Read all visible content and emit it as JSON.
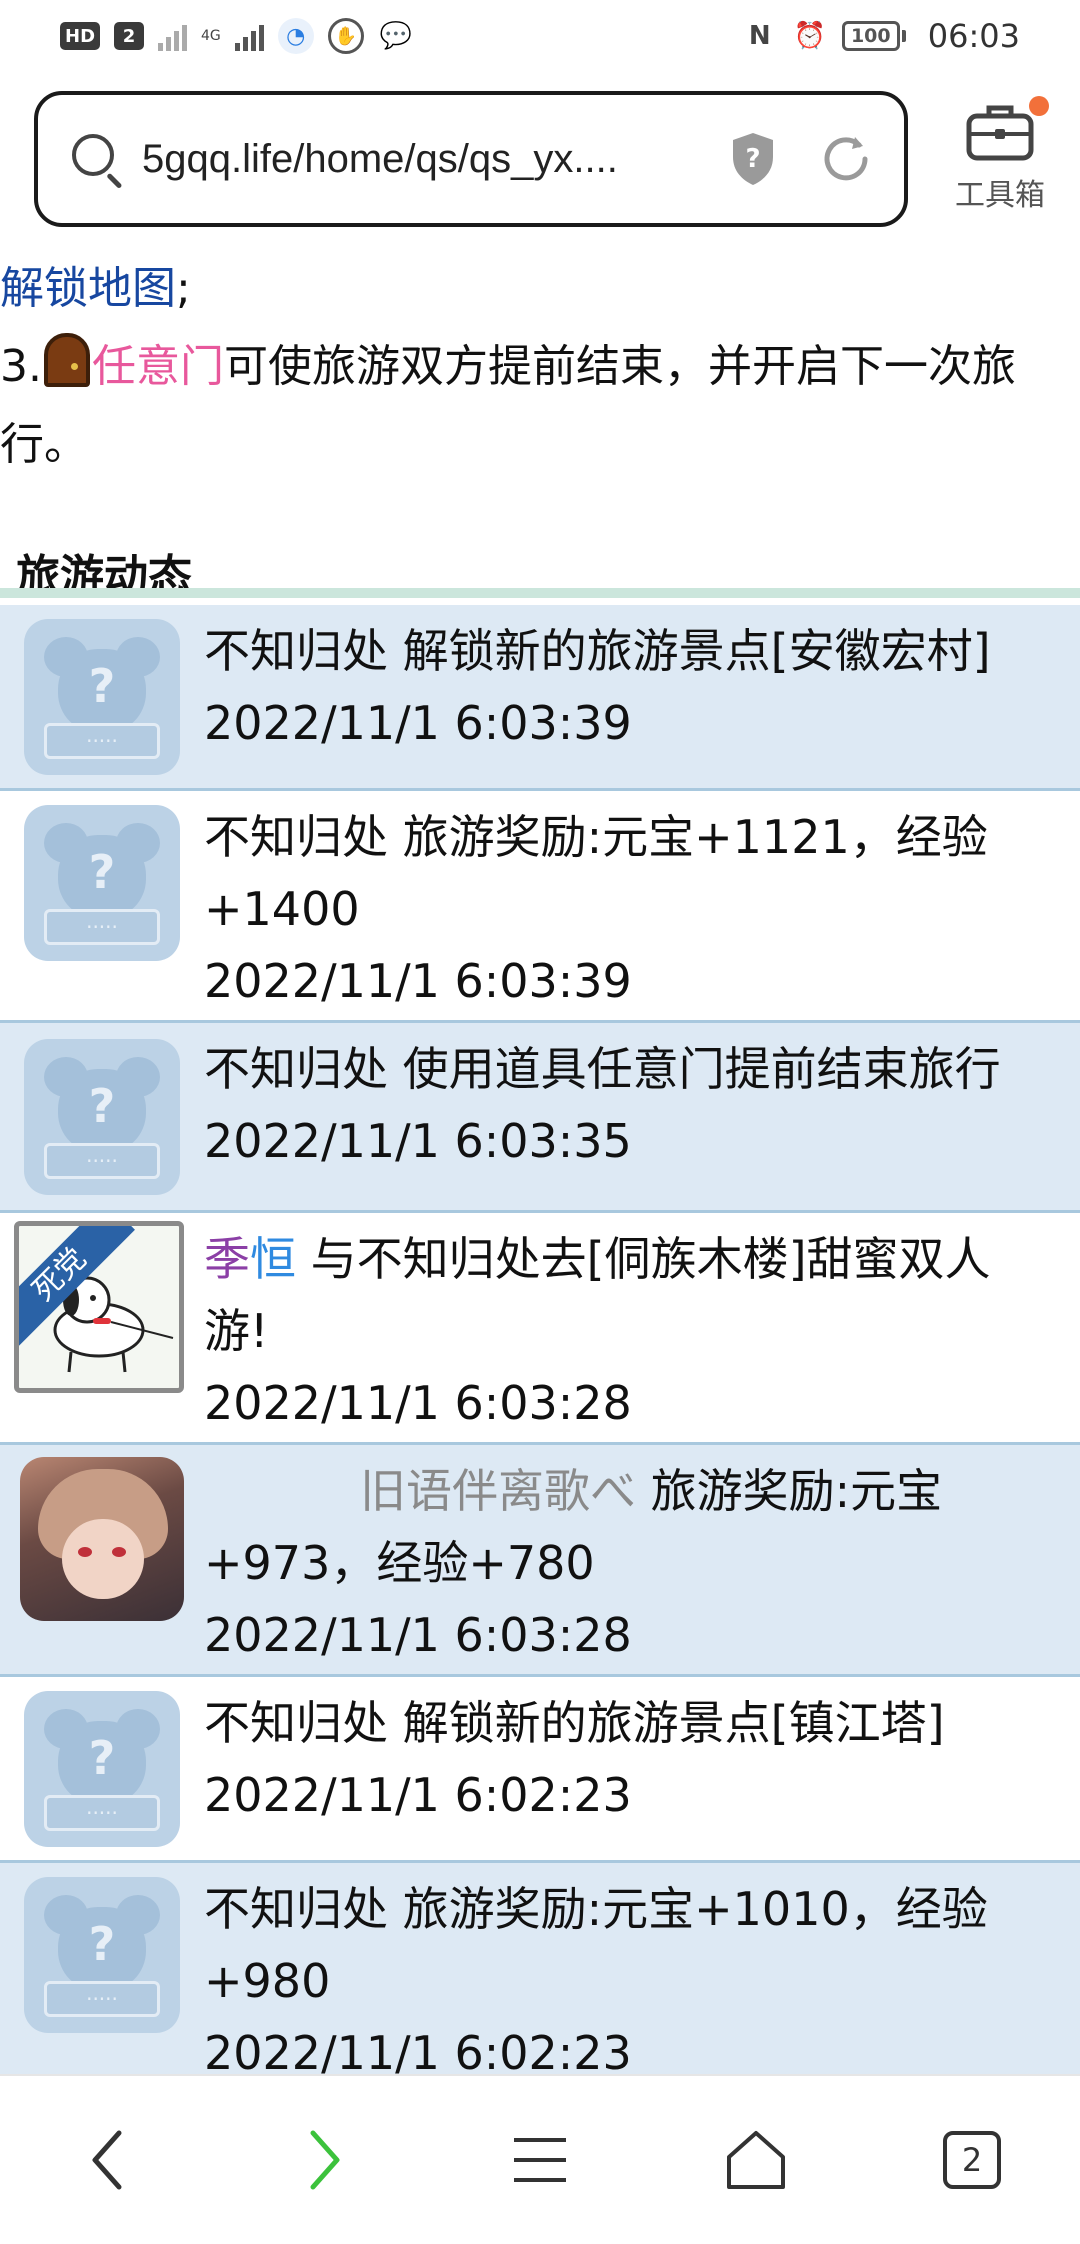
{
  "status_bar": {
    "hd_label": "HD",
    "sim_label": "2",
    "net_label": "4G",
    "battery": "100",
    "time": "06:03"
  },
  "browser": {
    "url": "5gqq.life/home/qs/qs_yx....",
    "toolbox_label": "工具箱"
  },
  "intro": {
    "link_map": "解锁地图",
    "link_map_suffix": ";",
    "line3_prefix": "3.",
    "door_link": "任意门",
    "line3_text": "可使旅游双方提前结束，并开启下一次旅行。"
  },
  "section": {
    "title": "旅游动态"
  },
  "feed": [
    {
      "text": "不知归处 解锁新的旅游景点[安徽宏村]",
      "time": "2022/11/1 6:03:39"
    },
    {
      "text": "不知归处 旅游奖励:元宝+1121，经验+1400",
      "time": "2022/11/1 6:03:39"
    },
    {
      "text": "不知归处 使用道具任意门提前结束旅行",
      "time": "2022/11/1 6:03:35"
    },
    {
      "name_part1": "季",
      "name_part2": "恒",
      "text": " 与不知归处去[侗族木楼]甜蜜双人游!",
      "time": "2022/11/1 6:03:28",
      "badge": "死党"
    },
    {
      "name": "旧语伴离歌べ",
      "text": " 旅游奖励:元宝+973，经验+780",
      "time": "2022/11/1 6:03:28"
    },
    {
      "text": "不知归处 解锁新的旅游景点[镇江塔]",
      "time": "2022/11/1 6:02:23"
    },
    {
      "text": "不知归处 旅游奖励:元宝+1010，经验+980",
      "time": "2022/11/1 6:02:23"
    }
  ],
  "bottom_nav": {
    "tab_count": "2"
  },
  "colors": {
    "row_blue": "#dde9f4",
    "link_blue": "#1747a0",
    "link_pink": "#e8589c",
    "name_purple": "#8b3fa6",
    "name_sky": "#2f8ae0",
    "forward_green": "#3cc23c",
    "notify_orange": "#f2703a"
  },
  "icons": [
    "search-icon",
    "shield-icon",
    "reload-icon",
    "toolbox-icon",
    "back-icon",
    "forward-icon",
    "menu-icon",
    "home-icon",
    "tabs-icon"
  ]
}
